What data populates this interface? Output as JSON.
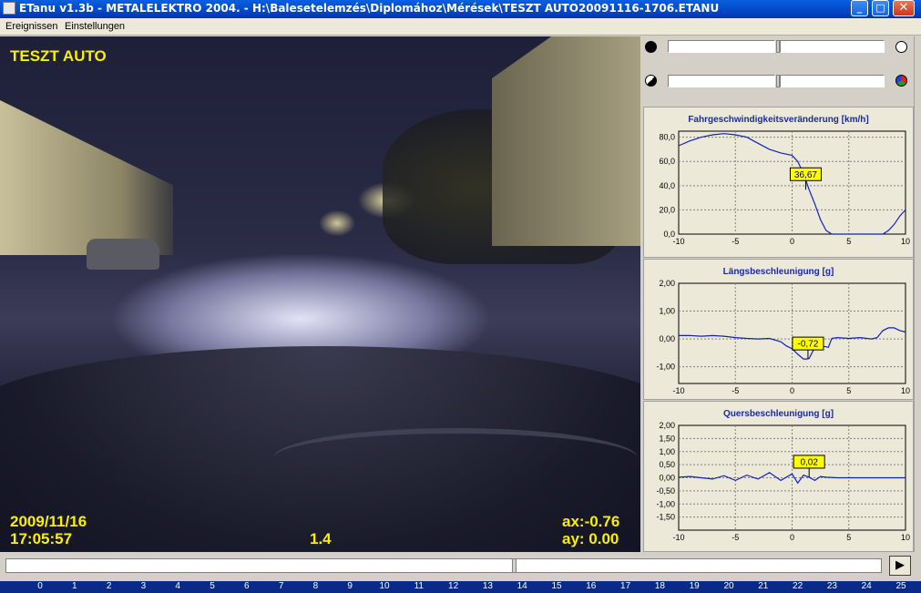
{
  "window": {
    "title": "ETanu v1.3b - METALELEKTRO 2004. - H:\\Balesetelemzés\\Diplomához\\Mérések\\TESZT AUTO20091116-1706.ETANU",
    "minimize": "_",
    "maximize": "□",
    "close": "✕"
  },
  "menu": [
    "Ereignissen",
    "Einstellungen"
  ],
  "video": {
    "label": "TESZT AUTO",
    "date": "2009/11/16",
    "time": "17:05:57",
    "speed_factor": "1.4",
    "ax": "ax:-0.76",
    "ay": "ay: 0.00"
  },
  "timeline": {
    "position": 0.578,
    "play": "▶",
    "ruler_ticks": [
      "0",
      "1",
      "2",
      "3",
      "4",
      "5",
      "6",
      "7",
      "8",
      "9",
      "10",
      "11",
      "12",
      "13",
      "14",
      "15",
      "16",
      "17",
      "18",
      "19",
      "20",
      "21",
      "22",
      "23",
      "24",
      "25"
    ]
  },
  "chart_data": [
    {
      "type": "line",
      "title": "Fahrgeschwindigkeitsveränderung [km/h]",
      "x": [
        -10,
        -9,
        -8,
        -7,
        -6,
        -5,
        -4,
        -3,
        -2,
        -1,
        0,
        0.5,
        1,
        1.5,
        2,
        2.5,
        3,
        3.5,
        4,
        5,
        6,
        7,
        7.5,
        8,
        8.5,
        9,
        9.5,
        10
      ],
      "series": [
        {
          "values": [
            73,
            77,
            80,
            82,
            83,
            82,
            80,
            75,
            70,
            67,
            65,
            60,
            50,
            36.67,
            25,
            12,
            3,
            0,
            0,
            0,
            0,
            0,
            0,
            0,
            3,
            8,
            15,
            20
          ]
        }
      ],
      "xlim": [
        -10,
        10
      ],
      "ylim": [
        0,
        85
      ],
      "yticks": [
        "0,0",
        "20,0",
        "40,0",
        "60,0",
        "80,0"
      ],
      "xticks": [
        "-10",
        "-5",
        "0",
        "5",
        "10"
      ],
      "annotation": {
        "x": 1.2,
        "y": 36.67,
        "text": "36,67"
      },
      "grid": true
    },
    {
      "type": "line",
      "title": "Längsbeschleunigung [g]",
      "x": [
        -10,
        -9,
        -8,
        -7,
        -6,
        -5,
        -4,
        -3,
        -2,
        -1,
        -0.5,
        0,
        0.5,
        1,
        1.3,
        1.5,
        2,
        2.5,
        3,
        3.2,
        3.5,
        4,
        5,
        6,
        7,
        7.5,
        8,
        8.5,
        9,
        9.5,
        10
      ],
      "series": [
        {
          "values": [
            0.12,
            0.12,
            0.1,
            0.12,
            0.1,
            0.05,
            0.02,
            0.0,
            0.02,
            -0.1,
            -0.25,
            -0.35,
            -0.55,
            -0.72,
            -0.72,
            -0.7,
            -0.3,
            -0.25,
            -0.28,
            -0.3,
            0.02,
            0.05,
            0.02,
            0.05,
            0.0,
            0.05,
            0.3,
            0.4,
            0.4,
            0.3,
            0.25
          ]
        }
      ],
      "xlim": [
        -10,
        10
      ],
      "ylim": [
        -1.6,
        2.0
      ],
      "yticks": [
        "2,00",
        "1,00",
        "0,00",
        "-1,00"
      ],
      "xticks": [
        "-10",
        "-5",
        "0",
        "5",
        "10"
      ],
      "annotation": {
        "x": 1.4,
        "y": -0.72,
        "text": "-0,72"
      },
      "grid": true
    },
    {
      "type": "line",
      "title": "Quersbeschleunigung [g]",
      "x": [
        -10,
        -9,
        -8,
        -7,
        -6,
        -5,
        -4,
        -3,
        -2,
        -1,
        0,
        0.5,
        1,
        1.5,
        2,
        2.5,
        3,
        4,
        5,
        6,
        7,
        8,
        9,
        10
      ],
      "series": [
        {
          "values": [
            0.02,
            0.05,
            0.0,
            -0.05,
            0.08,
            -0.1,
            0.1,
            -0.05,
            0.2,
            -0.1,
            0.15,
            -0.2,
            0.1,
            0.02,
            -0.1,
            0.05,
            0.02,
            0.0,
            0.0,
            0.0,
            0.0,
            0.0,
            0.0,
            0.0
          ]
        }
      ],
      "xlim": [
        -10,
        10
      ],
      "ylim": [
        -2.0,
        2.0
      ],
      "yticks": [
        "2,00",
        "1,50",
        "1,00",
        "0,50",
        "0,00",
        "-0,50",
        "-1,00",
        "-1,50"
      ],
      "xticks": [
        "-10",
        "-5",
        "0",
        "5",
        "10"
      ],
      "annotation": {
        "x": 1.5,
        "y": 0.02,
        "text": "0,02"
      },
      "grid": true
    }
  ]
}
